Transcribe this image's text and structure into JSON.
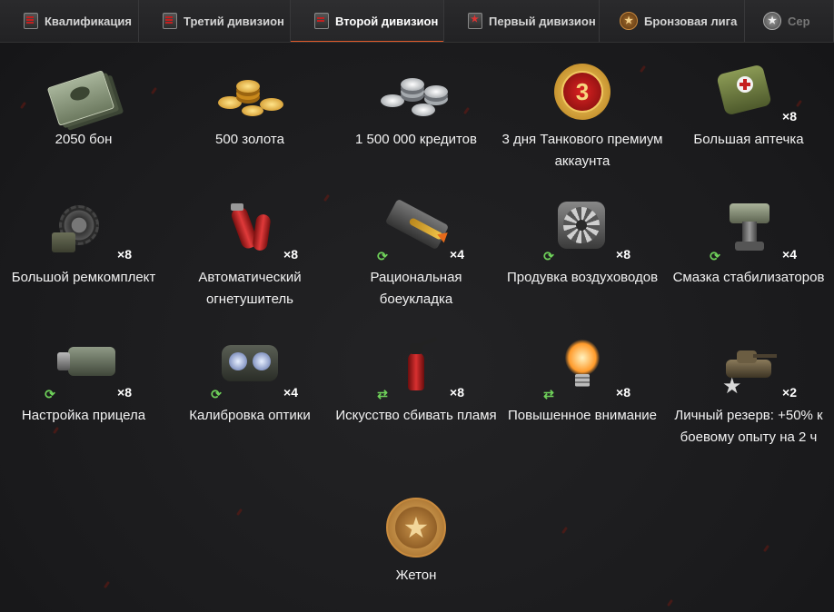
{
  "tabs": [
    {
      "label": "Квалификация",
      "icon": "division-badge-icon",
      "active": false
    },
    {
      "label": "Третий дивизион",
      "icon": "division-three-badge-icon",
      "active": false
    },
    {
      "label": "Второй дивизион",
      "icon": "division-two-badge-icon",
      "active": true
    },
    {
      "label": "Первый дивизион",
      "icon": "division-one-badge-icon",
      "active": false
    },
    {
      "label": "Бронзовая лига",
      "icon": "bronze-league-icon",
      "active": false
    },
    {
      "label": "Сер",
      "icon": "silver-league-icon",
      "active": false
    }
  ],
  "rewards": [
    {
      "label": "2050 бон",
      "count": "",
      "icon": "bonds-icon",
      "reusable": false
    },
    {
      "label": "500 золота",
      "count": "",
      "icon": "gold-coins-icon",
      "reusable": false
    },
    {
      "label": "1 500 000 кредитов",
      "count": "",
      "icon": "credits-icon",
      "reusable": false
    },
    {
      "label": "3 дня Танкового премиум аккаунта",
      "count": "",
      "icon": "premium-account-icon",
      "badge_number": "3",
      "reusable": false
    },
    {
      "label": "Большая аптечка",
      "count": "×8",
      "icon": "first-aid-kit-icon",
      "reusable": false
    },
    {
      "label": "Большой ремкомплект",
      "count": "×8",
      "icon": "repair-kit-icon",
      "reusable": false
    },
    {
      "label": "Автоматический огнетушитель",
      "count": "×8",
      "icon": "auto-extinguisher-icon",
      "reusable": false
    },
    {
      "label": "Рациональная боеукладка",
      "count": "×4",
      "icon": "ammo-rack-icon",
      "reusable": true
    },
    {
      "label": "Продувка воздуховодов",
      "count": "×8",
      "icon": "air-duct-fan-icon",
      "reusable": true
    },
    {
      "label": "Смазка стабилизаторов",
      "count": "×4",
      "icon": "stabilizer-lubricant-icon",
      "reusable": true
    },
    {
      "label": "Настройка прицела",
      "count": "×8",
      "icon": "aim-tuning-icon",
      "reusable": true
    },
    {
      "label": "Калибровка оптики",
      "count": "×4",
      "icon": "optics-calibration-icon",
      "reusable": true
    },
    {
      "label": "Искусство сбивать пламя",
      "count": "×8",
      "icon": "fire-extinguisher-icon",
      "reusable": true
    },
    {
      "label": "Повышенное внимание",
      "count": "×8",
      "icon": "light-bulb-icon",
      "reusable": true
    },
    {
      "label": "Личный резерв: +50% к боевому опыту на 2 ч",
      "count": "×2",
      "icon": "personal-reserve-tank-icon",
      "reusable": false
    },
    {
      "label": "Жетон",
      "count": "",
      "icon": "token-star-icon",
      "reusable": false
    }
  ],
  "colors": {
    "accent": "#e05a2a",
    "cycle": "#6fd25a",
    "background": "#1c1c1e"
  }
}
